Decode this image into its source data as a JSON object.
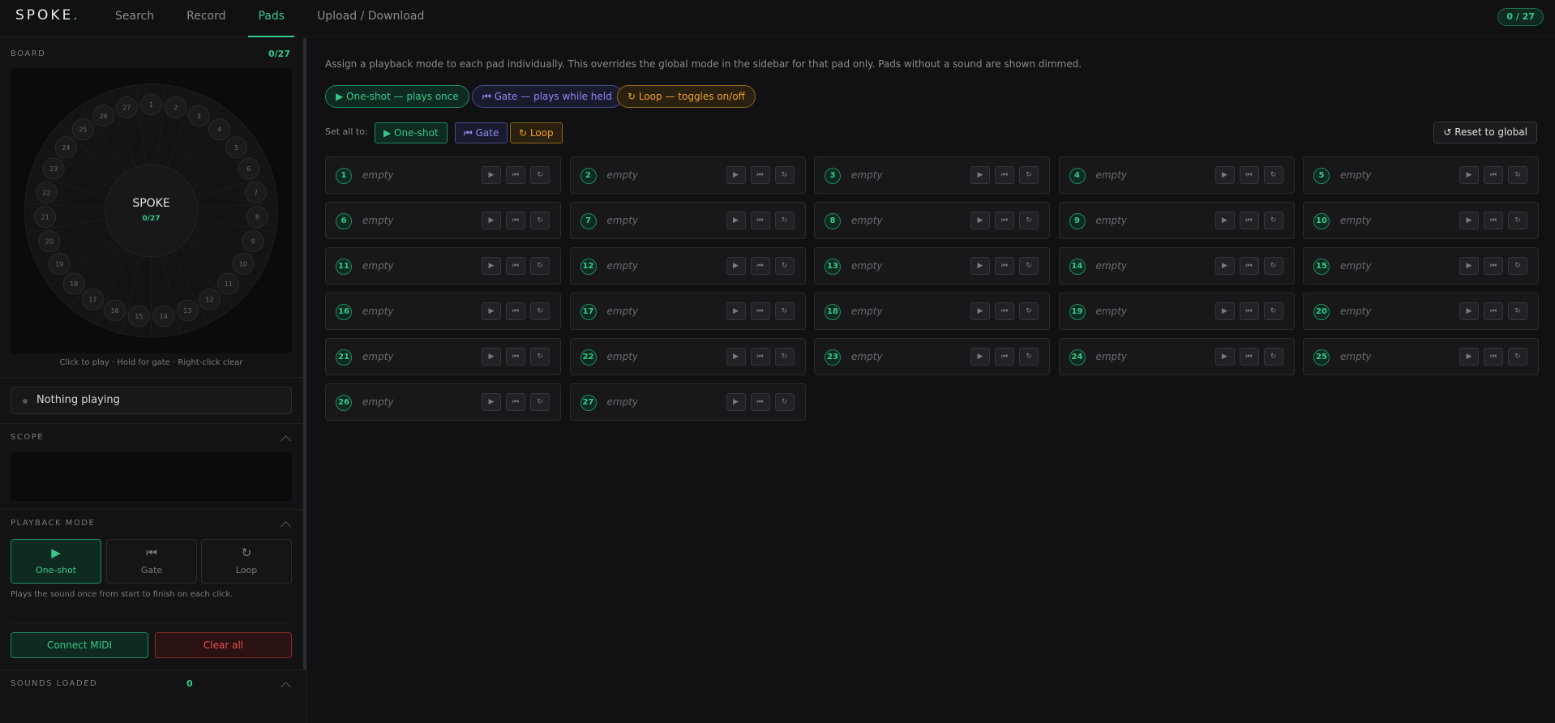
{
  "app": {
    "logo": "SPOKE",
    "logo_dot": ".",
    "count_pill": "0 / 27"
  },
  "nav": {
    "tabs": [
      {
        "label": "Search",
        "active": false
      },
      {
        "label": "Record",
        "active": false
      },
      {
        "label": "Pads",
        "active": true
      },
      {
        "label": "Upload / Download",
        "active": false
      }
    ]
  },
  "sidebar": {
    "board_label": "BOARD",
    "board_count": "0/27",
    "wheel_title": "SPOKE",
    "wheel_count": "0/27",
    "pad_numbers": [
      "1",
      "2",
      "3",
      "4",
      "5",
      "6",
      "7",
      "8",
      "9",
      "10",
      "11",
      "12",
      "13",
      "14",
      "15",
      "16",
      "17",
      "18",
      "19",
      "20",
      "21",
      "22",
      "23",
      "24",
      "25",
      "26",
      "27"
    ],
    "hint": "Click to play · Hold for gate · Right-click clear",
    "now_playing": "Nothing playing",
    "scope_label": "SCOPE",
    "playback_label": "PLAYBACK MODE",
    "modes": [
      {
        "label": "One-shot",
        "icon": "play-icon",
        "glyph": "▶",
        "active": true
      },
      {
        "label": "Gate",
        "icon": "gate-icon",
        "glyph": "⏮",
        "active": false
      },
      {
        "label": "Loop",
        "icon": "loop-icon",
        "glyph": "↻",
        "active": false
      }
    ],
    "mode_desc": "Plays the sound once from start to finish on each click.",
    "connect_midi": "Connect MIDI",
    "clear_all": "Clear all",
    "sounds_loaded_label": "SOUNDS LOADED",
    "sounds_loaded_count": "0"
  },
  "main": {
    "intro": "Assign a playback mode to each pad individually. This overrides the global mode in the sidebar for that pad only. Pads without a sound are shown dimmed.",
    "legend": {
      "oneshot": "▶ One-shot — plays once",
      "gate": "⏮ Gate — plays while held",
      "loop": "↻ Loop — toggles on/off"
    },
    "set_all_label": "Set all to:",
    "set_all": {
      "oneshot": "▶ One-shot",
      "gate": "⏮ Gate",
      "loop": "↻ Loop"
    },
    "reset": "↺ Reset to global",
    "empty_label": "empty",
    "pad_buttons": [
      "▶",
      "⏮",
      "↻"
    ]
  },
  "colors": {
    "accent": "#35c98b",
    "gate": "#8a8af0",
    "loop": "#f0a030",
    "danger": "#ef4d4d"
  }
}
